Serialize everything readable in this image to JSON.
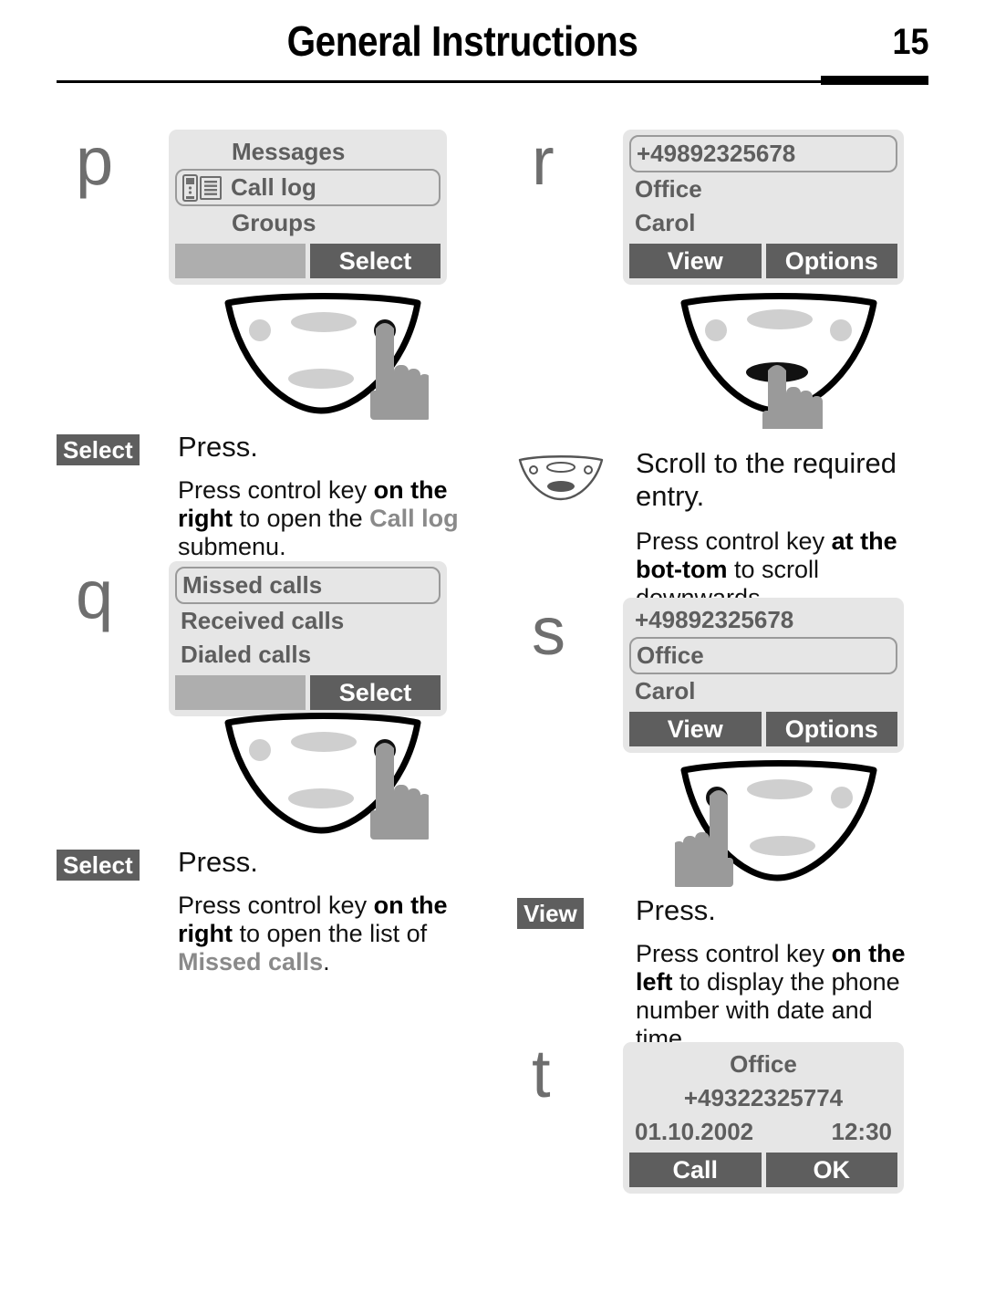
{
  "header": {
    "title": "General Instructions",
    "page_number": "15"
  },
  "steps": {
    "p": "p",
    "q": "q",
    "r": "r",
    "s": "s",
    "t": "t"
  },
  "screens": {
    "menu_call_log": {
      "rows": [
        "Messages",
        "Call log",
        "Groups"
      ],
      "selected": "Call log",
      "icon": "call-log-icon",
      "softkey_left": "",
      "softkey_right": "Select"
    },
    "call_log_list": {
      "rows": [
        "Missed calls",
        "Received calls",
        "Dialed calls"
      ],
      "selected": "Missed calls",
      "softkey_left": "",
      "softkey_right": "Select"
    },
    "missed_list_1": {
      "rows": [
        "+49892325678",
        "Office",
        "Carol"
      ],
      "selected": "+49892325678",
      "softkey_left": "View",
      "softkey_right": "Options"
    },
    "missed_list_2": {
      "rows": [
        "+49892325678",
        "Office",
        "Carol"
      ],
      "selected": "Office",
      "softkey_left": "View",
      "softkey_right": "Options"
    },
    "detail": {
      "name": "Office",
      "number": "+49322325774",
      "date": "01.10.2002",
      "time": "12:30",
      "softkey_left": "Call",
      "softkey_right": "OK"
    }
  },
  "instructions": {
    "select_1": {
      "badge": "Select",
      "title": "Press.",
      "body_1": "Press control key ",
      "body_bold": "on the right",
      "body_2": " to open the ",
      "body_gray": "Call log",
      "body_3": " submenu."
    },
    "select_2": {
      "badge": "Select",
      "title": "Press.",
      "body_1": "Press control key ",
      "body_bold": "on the right",
      "body_2": " to open the list of ",
      "body_gray": "Missed calls",
      "body_3": "."
    },
    "scroll": {
      "icon": "control-key-bottom-icon",
      "title_line1": "Scroll to the required",
      "title_line2": "entry.",
      "body_1": "Press control key ",
      "body_bold": "at the bot-",
      "body_bold_2": "tom",
      "body_2": " to scroll downwards."
    },
    "view": {
      "badge": "View",
      "title": "Press.",
      "body_1": "Press control key ",
      "body_bold": "on the left",
      "body_2": " to display the phone number with date and time."
    }
  },
  "colors": {
    "display_bg": "#e6e6e6",
    "softkey_dark": "#5e5e5e",
    "softkey_light": "#aeaeae",
    "display_text": "#5e5e5e",
    "marker": "#6e6e6e",
    "hand": "#9a9a9a"
  }
}
